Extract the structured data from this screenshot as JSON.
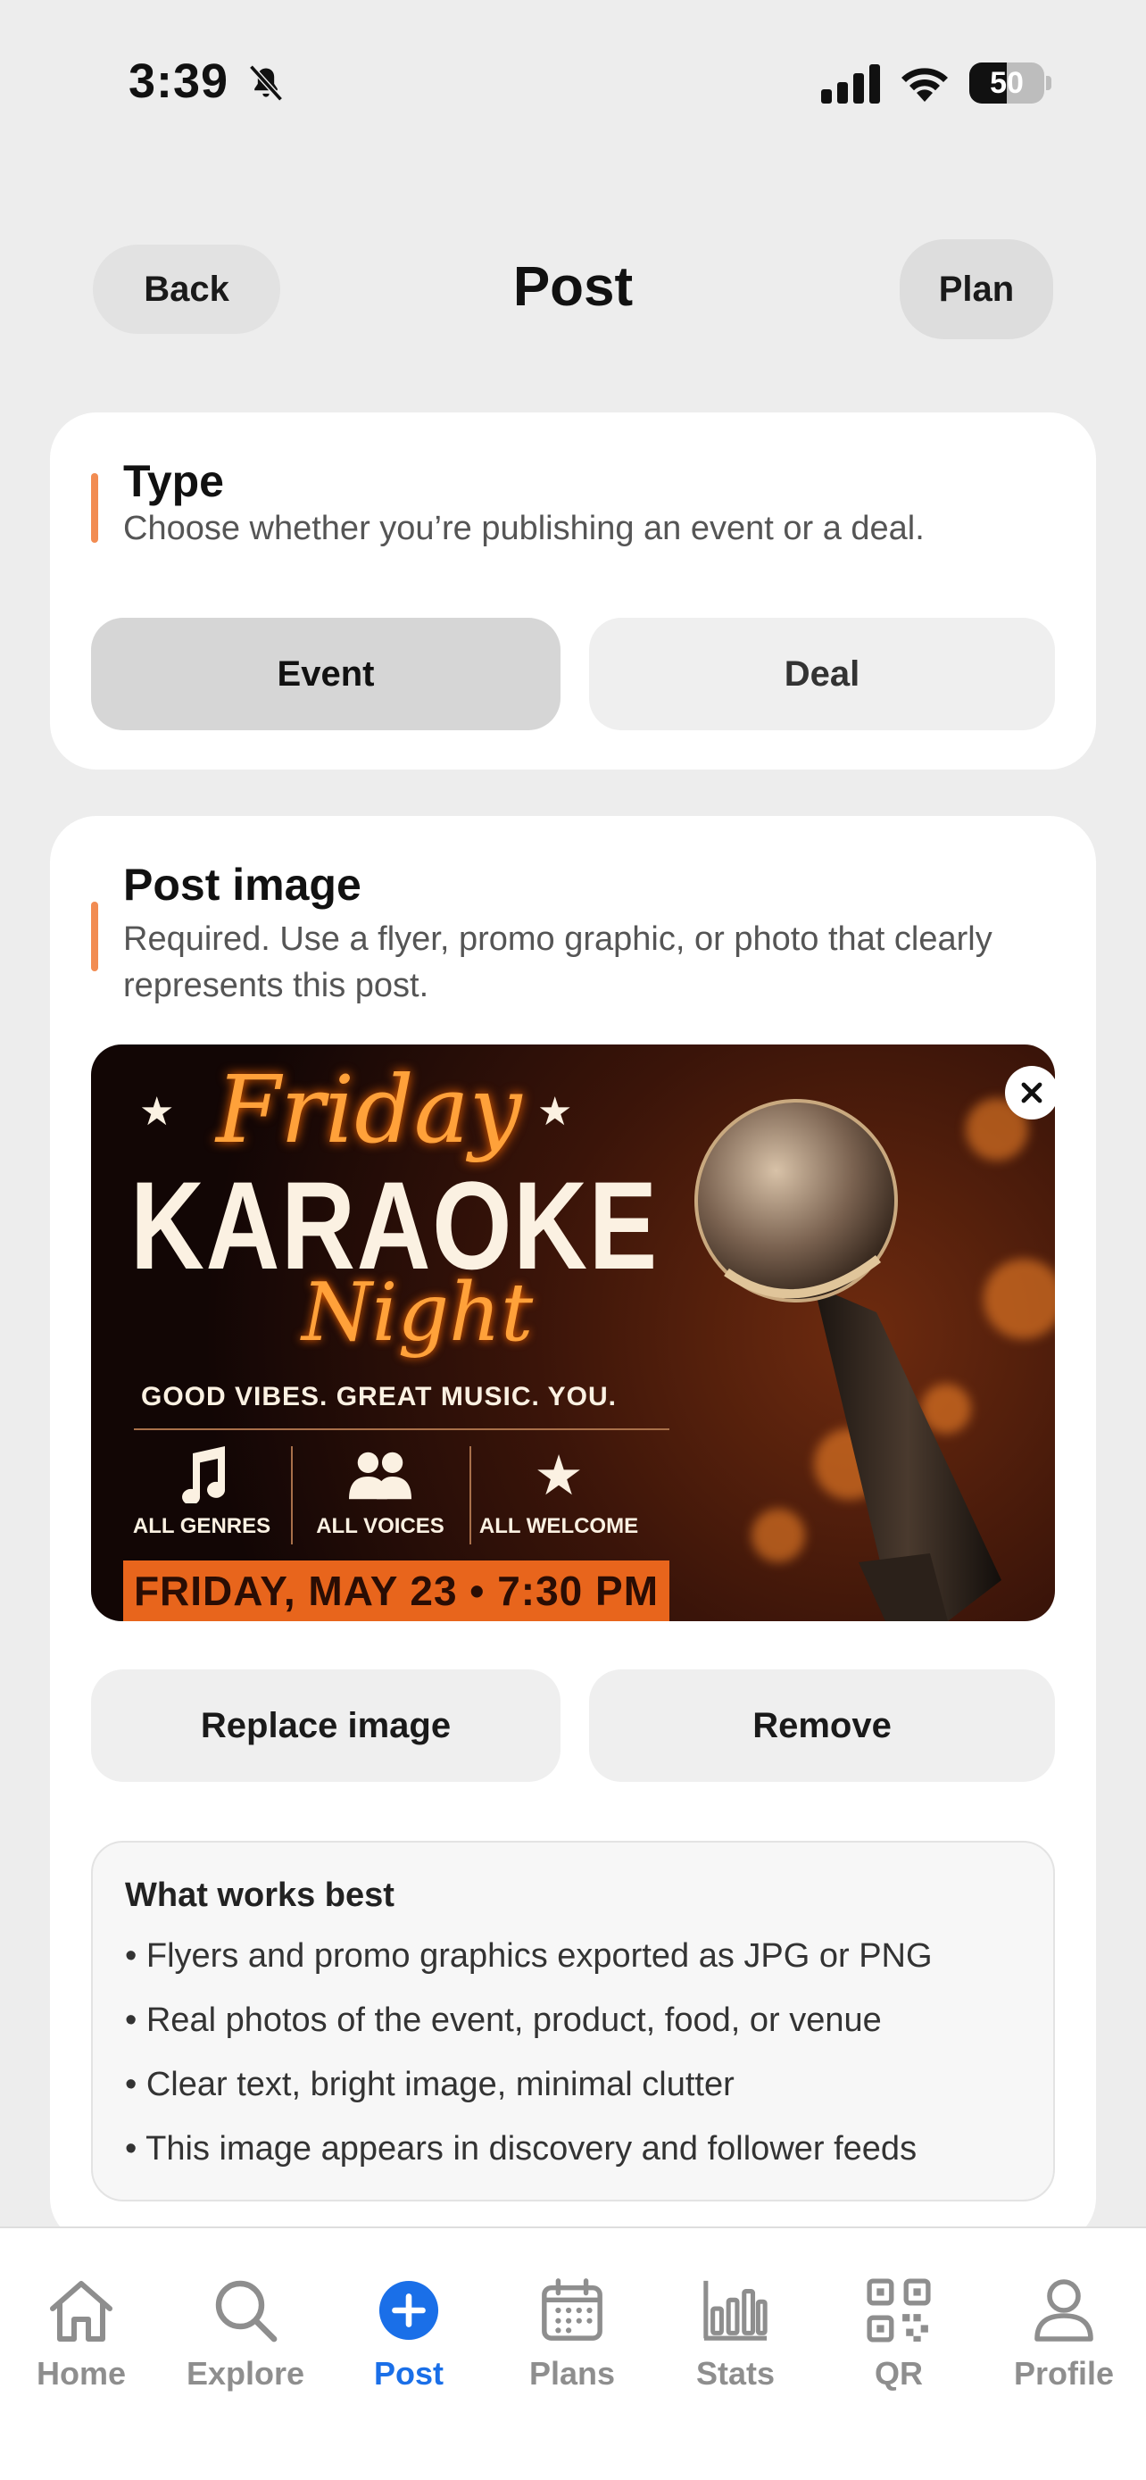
{
  "status_bar": {
    "time": "3:39",
    "battery": "50",
    "battery_level": 0.5
  },
  "header": {
    "back_label": "Back",
    "title": "Post",
    "plan_label": "Plan"
  },
  "type_section": {
    "title": "Type",
    "description": "Choose whether you’re publishing an event or a deal.",
    "options": [
      {
        "label": "Event",
        "selected": true
      },
      {
        "label": "Deal",
        "selected": false
      }
    ]
  },
  "image_section": {
    "title": "Post image",
    "description": "Required. Use a flyer, promo graphic, or photo that clearly represents this post.",
    "flyer": {
      "line1": "Friday",
      "line2": "KARAOKE",
      "line3": "Night",
      "tagline": "GOOD VIBES.  GREAT MUSIC.  YOU.",
      "features": [
        "ALL GENRES",
        "ALL VOICES",
        "ALL WELCOME"
      ],
      "date": "FRIDAY, MAY 23 • 7:30 PM"
    },
    "replace_label": "Replace image",
    "remove_label": "Remove",
    "tips": {
      "title": "What works best",
      "items": [
        "• Flyers and promo graphics exported as JPG or PNG",
        "• Real photos of the event, product, food, or venue",
        "• Clear text, bright image, minimal clutter",
        "• This image appears in discovery and follower feeds"
      ]
    }
  },
  "tab_bar": {
    "active": "Post",
    "tabs": [
      {
        "label": "Home",
        "icon": "home-icon"
      },
      {
        "label": "Explore",
        "icon": "search-icon"
      },
      {
        "label": "Post",
        "icon": "plus-circle-icon"
      },
      {
        "label": "Plans",
        "icon": "calendar-icon"
      },
      {
        "label": "Stats",
        "icon": "bar-chart-icon"
      },
      {
        "label": "QR",
        "icon": "qr-code-icon"
      },
      {
        "label": "Profile",
        "icon": "person-icon"
      }
    ]
  },
  "colors": {
    "accent": "#f28c52",
    "active_tab": "#1a6fe8",
    "background": "#ededed"
  }
}
